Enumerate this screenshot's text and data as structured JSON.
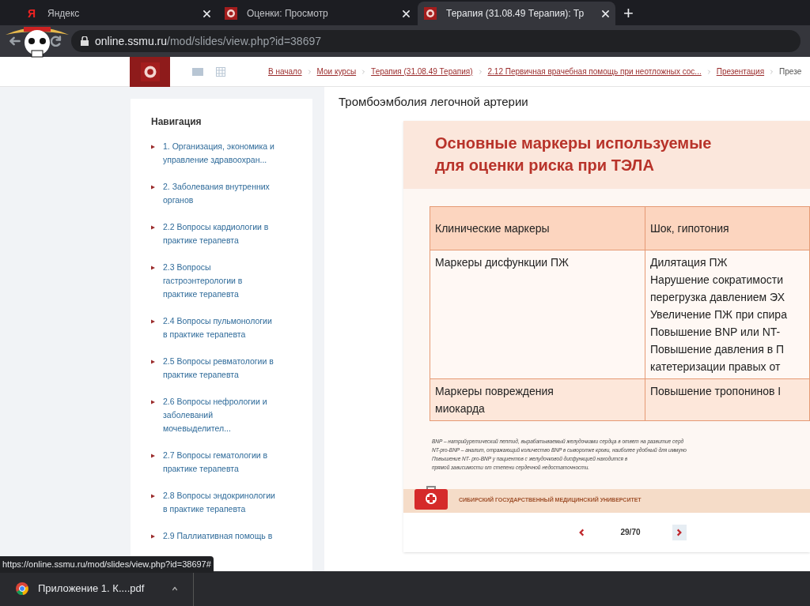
{
  "browser": {
    "tabs": [
      {
        "title": "Яндекс",
        "kind": "letter",
        "logo_text": "Я",
        "selected": false
      },
      {
        "title": "Оценки: Просмотр",
        "kind": "crest",
        "selected": false
      },
      {
        "title": "Терапия (31.08.49 Терапия): Тр",
        "kind": "crest",
        "selected": true
      }
    ],
    "new_tab": "+",
    "url_host": "online.ssmu.ru",
    "url_path": "/mod/slides/view.php?id=38697"
  },
  "breadcrumbs": [
    {
      "label": "В начало",
      "kind": "link"
    },
    {
      "label": "Мои курсы",
      "kind": "link"
    },
    {
      "label": "Терапия (31.08.49 Терапия)",
      "kind": "link"
    },
    {
      "label": "2.12 Первичная врачебная помощь при неотложных сос...",
      "kind": "link"
    },
    {
      "label": "Презентация",
      "kind": "link"
    },
    {
      "label": "Презе",
      "kind": "current"
    }
  ],
  "navigation": {
    "title": "Навигация",
    "items": [
      "1. Организация, экономика и управление здравоохран...",
      "2. Заболевания внутренних органов",
      "2.2 Вопросы кардиологии в практике терапевта",
      "2.3 Вопросы гастроэнтерологии в практике терапевта",
      "2.4 Вопросы пульмонологии в практике терапевта",
      "2.5 Вопросы ревматологии в практике терапевта",
      "2.6 Вопросы нефрологии и заболеваний мочевыделител...",
      "2.7 Вопросы гематологии в практике терапевта",
      "2.8 Вопросы эндокринологии в практике терапевта",
      "2.9 Паллиативная помощь в"
    ]
  },
  "page_title": "Тромбоэмболия легочной артерии",
  "slide": {
    "title": "Основные маркеры используемые для оценки риска при ТЭЛА",
    "table": [
      {
        "kind": "header",
        "cells": [
          [
            "Клинические маркеры"
          ],
          [
            "Шок, гипотония"
          ]
        ]
      },
      {
        "kind": "body",
        "cells": [
          [
            "Маркеры дисфункции ПЖ"
          ],
          [
            "Дилятация ПЖ",
            "Нарушение сократимости",
            "перегрузка давлением ЭХ",
            "Увеличение ПЖ при спира",
            "Повышение BNP или NT-",
            "Повышение давления в П",
            "катетеризации правых от"
          ]
        ]
      },
      {
        "kind": "shaded",
        "cells": [
          [
            "Маркеры повреждения",
            "миокарда"
          ],
          [
            "Повышение тропонинов I"
          ]
        ]
      }
    ],
    "footnotes": [
      "BNP – натрийуретический пептид, вырабатываемый желудочками сердца в ответ на развитие серд",
      "NT-pro-BNP – аналит, отражающий количество BNP в сыворотке крови, наиболее удобный для иммуно",
      "Повышение NT- pro-BNP у пациентов с желудочковой дисфункцией находится в",
      "прямой зависимости от степени сердечной недостаточности."
    ],
    "footer": "СИБИРСКИЙ ГОСУДАРСТВЕННЫЙ МЕДИЦИНСКИЙ УНИВЕРСИТЕТ"
  },
  "pager": {
    "counter": "29/70"
  },
  "status_url": "https://online.ssmu.ru/mod/slides/view.php?id=38697#",
  "downloads": [
    {
      "name": "Приложение 1. К....pdf"
    }
  ]
}
